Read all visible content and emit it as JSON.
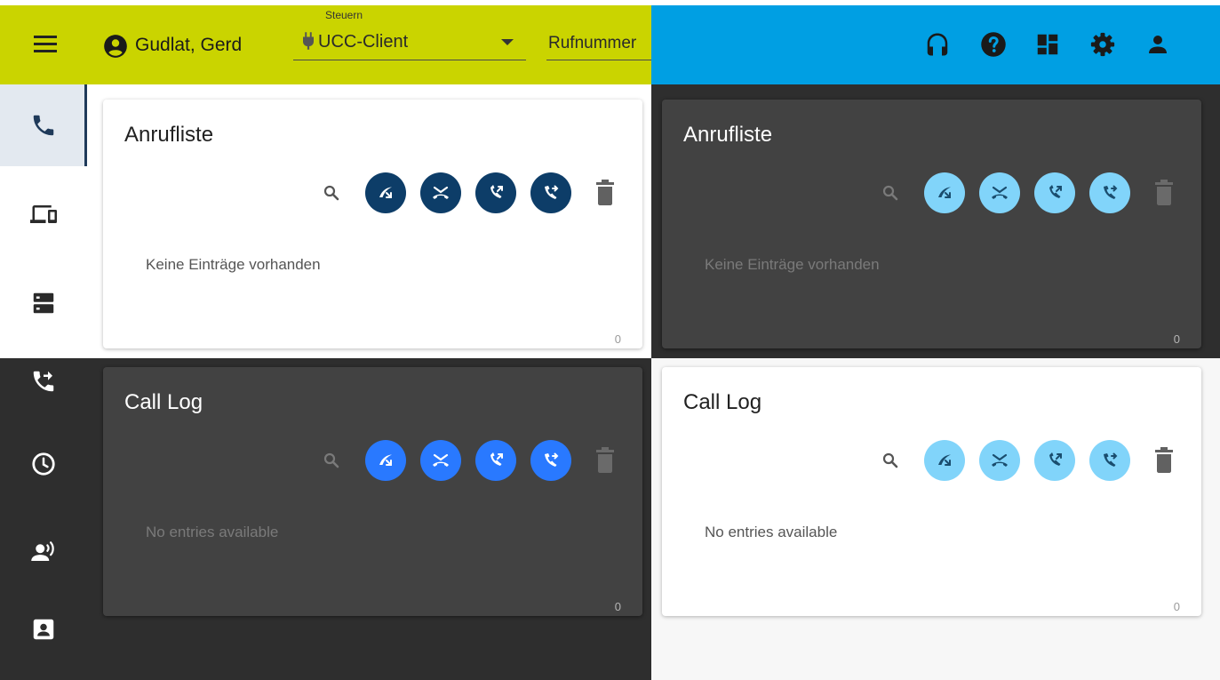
{
  "header": {
    "user_name": "Gudlat, Gerd",
    "control_label": "Steuern",
    "client_select_value": "UCC-Client",
    "phone_placeholder": "Rufnummer",
    "left_bar_color": "#cad400",
    "right_bar_color": "#009fe3",
    "icons": [
      "headset-icon",
      "help-icon",
      "dashboard-icon",
      "settings-icon",
      "account-icon"
    ]
  },
  "sidebar": {
    "items": [
      {
        "icon": "phone-icon",
        "active": true
      },
      {
        "icon": "devices-icon",
        "active": false
      },
      {
        "icon": "server-icon",
        "active": false
      },
      {
        "icon": "call-forward-icon",
        "active": false
      },
      {
        "icon": "clock-icon",
        "active": false
      },
      {
        "icon": "voice-person-icon",
        "active": false
      },
      {
        "icon": "contact-card-icon",
        "active": false
      }
    ]
  },
  "cards": [
    {
      "theme": "light",
      "title": "Anrufliste",
      "empty_text": "Keine Einträge vorhanden",
      "count": "0",
      "filter_color": "#0d3d68",
      "filter_icon_color": "#ffffff"
    },
    {
      "theme": "dark",
      "title": "Anrufliste",
      "empty_text": "Keine Einträge vorhanden",
      "count": "0",
      "filter_color": "#81d4fa",
      "filter_icon_color": "#1a4d6e"
    },
    {
      "theme": "dark",
      "title": "Call Log",
      "empty_text": "No entries available",
      "count": "0",
      "filter_color": "#2979ff",
      "filter_icon_color": "#ffffff"
    },
    {
      "theme": "light",
      "title": "Call Log",
      "empty_text": "No entries available",
      "count": "0",
      "filter_color": "#81d4fa",
      "filter_icon_color": "#1a4d6e"
    }
  ],
  "filters": [
    "incoming-call-icon",
    "missed-call-icon",
    "outgoing-call-icon",
    "forwarded-call-icon"
  ]
}
